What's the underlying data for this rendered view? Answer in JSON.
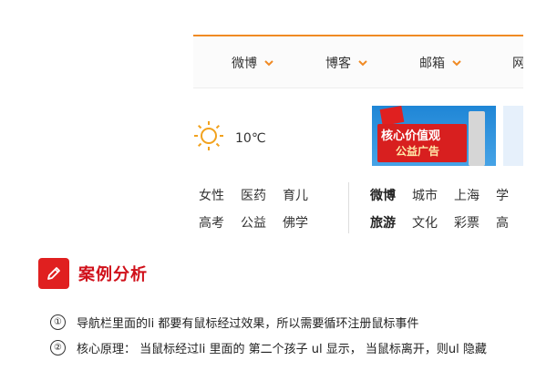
{
  "nav": {
    "items": [
      {
        "label": "微博"
      },
      {
        "label": "博客"
      },
      {
        "label": "邮箱"
      },
      {
        "label": "网"
      }
    ]
  },
  "weather": {
    "temp": "10℃",
    "icon": "sun-icon"
  },
  "banner": {
    "line1": "核心价值观",
    "line2": "公益广告"
  },
  "links": {
    "left_row1": [
      "女性",
      "医药",
      "育儿"
    ],
    "left_row2": [
      "高考",
      "公益",
      "佛学"
    ],
    "right_row1": [
      "微博",
      "城市",
      "上海",
      "学"
    ],
    "right_row2": [
      "旅游",
      "文化",
      "彩票",
      "高"
    ]
  },
  "section": {
    "title": "案例分析",
    "icon": "pencil-icon",
    "points": [
      {
        "num": "①",
        "text": "导航栏里面的li 都要有鼠标经过效果，所以需要循环注册鼠标事件"
      },
      {
        "num": "②",
        "text": "核心原理：  当鼠标经过li 里面的 第二个孩子 ul 显示，  当鼠标离开，则ul 隐藏"
      }
    ]
  },
  "colors": {
    "accent": "#f08a24",
    "title_red": "#d0101a",
    "icon_red": "#e02020"
  }
}
